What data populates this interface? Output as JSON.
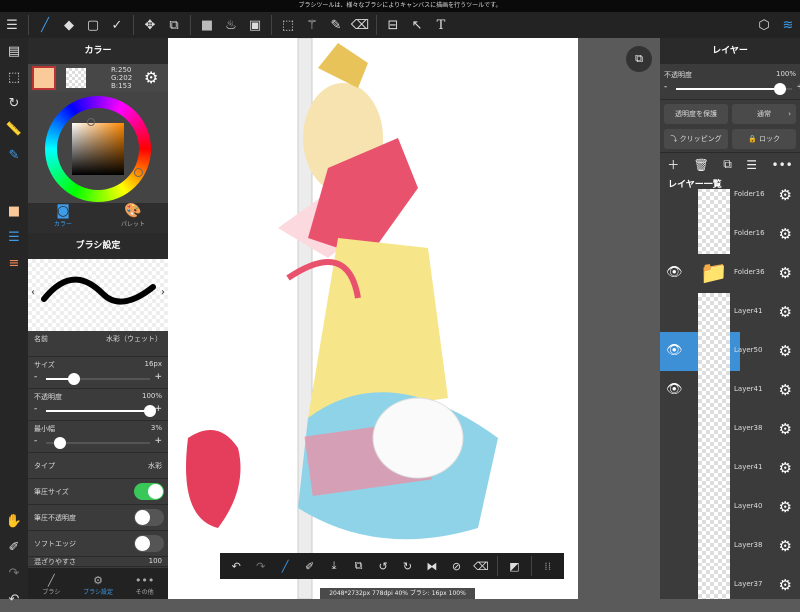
{
  "notice": "ブラシツールは、様々なブラシによりキャンバスに描画を行うツールです。",
  "color_panel": {
    "title": "カラー",
    "rgb": {
      "r": "R:250",
      "g": "G:202",
      "b": "B:153"
    },
    "primary": "#FACA99",
    "tabs": [
      "カラー",
      "パレット"
    ]
  },
  "brush_panel": {
    "title": "ブラシ設定",
    "name_label": "名前",
    "name_value": "水彩（ウェット）",
    "size_label": "サイズ",
    "size_value": "16px",
    "size_fraction": 0.27,
    "opacity_label": "不透明度",
    "opacity_value": "100%",
    "opacity_fraction": 1.0,
    "minwidth_label": "最小幅",
    "minwidth_value": "3%",
    "minwidth_fraction": 0.03,
    "type_label": "タイプ",
    "type_value": "水彩",
    "toggles": [
      {
        "label": "筆圧サイズ",
        "on": true
      },
      {
        "label": "筆圧不透明度",
        "on": false
      },
      {
        "label": "ソフトエッジ",
        "on": false
      }
    ],
    "blend_label": "混ざりやすさ",
    "blend_value": "100"
  },
  "bottom_tabs": [
    "ブラシ",
    "ブラシ設定",
    "その他"
  ],
  "layer_panel": {
    "title": "レイヤー",
    "opacity_label": "不透明度",
    "opacity_value": "100%",
    "opacity_fraction": 1.0,
    "protect_alpha": "透明度を保護",
    "blend_mode": "通常",
    "clipping": "クリッピング",
    "lock": "ロック",
    "list_title": "レイヤー一覧",
    "layers": [
      {
        "name": "Folder16",
        "visible": false
      },
      {
        "name": "Folder16",
        "visible": false
      },
      {
        "name": "Folder36",
        "visible": true,
        "folder": true
      },
      {
        "name": "Layer41",
        "visible": false
      },
      {
        "name": "Layer50",
        "visible": true,
        "selected": true
      },
      {
        "name": "Layer41",
        "visible": true
      },
      {
        "name": "Layer38",
        "visible": false
      },
      {
        "name": "Layer41",
        "visible": false
      },
      {
        "name": "Layer40",
        "visible": false
      },
      {
        "name": "Layer38",
        "visible": false
      },
      {
        "name": "Layer37",
        "visible": false
      }
    ]
  },
  "status": "2048*2732px 778dpi 40% ブラシ: 16px 100%",
  "accent": "#3d8fd6"
}
